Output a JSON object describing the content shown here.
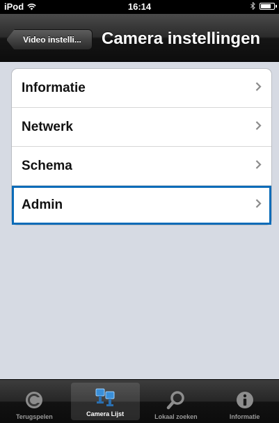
{
  "status_bar": {
    "device": "iPod",
    "time": "16:14",
    "battery_level": 0.8
  },
  "nav": {
    "back_label": "Video instelli...",
    "title": "Camera instellingen"
  },
  "menu": {
    "items": [
      {
        "label": "Informatie"
      },
      {
        "label": "Netwerk"
      },
      {
        "label": "Schema"
      },
      {
        "label": "Admin"
      }
    ],
    "selected_index": 3,
    "accent": "#0a6bb8"
  },
  "tabs": [
    {
      "label": "Terugspelen",
      "icon": "playback-icon"
    },
    {
      "label": "Camera Lijst",
      "icon": "camera-list-icon"
    },
    {
      "label": "Lokaal zoeken",
      "icon": "search-icon"
    },
    {
      "label": "Informatie",
      "icon": "info-icon"
    }
  ],
  "active_tab": 1
}
